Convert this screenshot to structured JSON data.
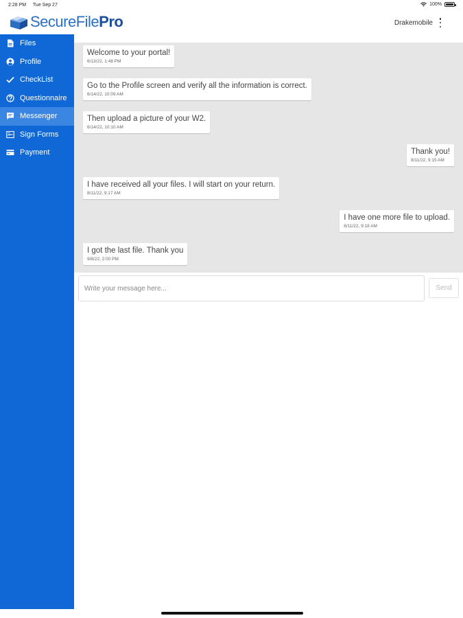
{
  "status_bar": {
    "time": "2:28 PM",
    "date": "Tue Sep 27",
    "battery": "100%",
    "battery_level": 1.0
  },
  "header": {
    "logo_main": "SecureFile",
    "logo_accent": "Pro",
    "user": "Drakemobile"
  },
  "sidebar": {
    "items": [
      {
        "label": "Files",
        "icon": "file-icon"
      },
      {
        "label": "Profile",
        "icon": "user-icon"
      },
      {
        "label": "CheckList",
        "icon": "check-icon"
      },
      {
        "label": "Questionnaire",
        "icon": "question-icon"
      },
      {
        "label": "Messenger",
        "icon": "message-icon",
        "active": true
      },
      {
        "label": "Sign Forms",
        "icon": "sign-icon"
      },
      {
        "label": "Payment",
        "icon": "card-icon"
      }
    ]
  },
  "messages": [
    {
      "text": "Welcome to your portal!",
      "time": "6/13/22, 1:48 PM",
      "side": "left"
    },
    {
      "text": "Go to the Profile screen and verify all the information is correct.",
      "time": "6/14/22, 10:09 AM",
      "side": "left"
    },
    {
      "text": "Then upload a picture of your W2.",
      "time": "6/14/22, 10:10 AM",
      "side": "left"
    },
    {
      "text": "Thank you!",
      "time": "8/11/22, 9:15 AM",
      "side": "right"
    },
    {
      "text": "I have received all your files. I will start on your return.",
      "time": "8/11/22, 9:17 AM",
      "side": "left"
    },
    {
      "text": "I have one more file to upload.",
      "time": "8/11/22, 9:18 AM",
      "side": "right"
    },
    {
      "text": "I got the last file. Thank you",
      "time": "9/8/22, 2:00 PM",
      "side": "left"
    }
  ],
  "compose": {
    "placeholder": "Write your message here...",
    "value": "",
    "send_label": "Send"
  },
  "colors": {
    "sidebar": "#1068d6",
    "sidebar_active": "#3b86e3",
    "chat_bg": "#e6e6e6",
    "logo": "#2a6fc4"
  }
}
